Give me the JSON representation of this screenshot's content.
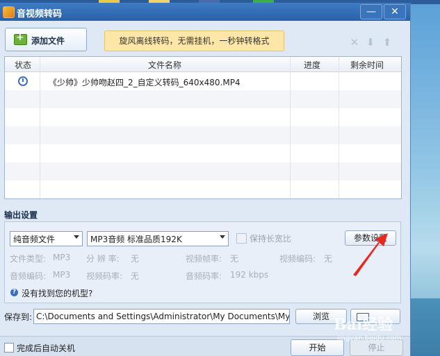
{
  "window": {
    "title": "音视频转码"
  },
  "toolbar": {
    "add_file_label": "添加文件",
    "banner_text": "旋风离线转码，无需挂机，一秒钟转格式"
  },
  "file_list": {
    "columns": [
      "状态",
      "文件名称",
      "进度",
      "剩余时间"
    ],
    "rows": [
      {
        "status_icon": "clock-icon",
        "name": "《少帅》少帅吻赵四_2_自定义转码_640x480.MP4",
        "progress": "",
        "remaining": ""
      }
    ]
  },
  "output_settings": {
    "section_label": "输出设置",
    "format_select": "纯音频文件",
    "preset_select": "MP3音频 标准品质192K",
    "keep_ratio_label": "保持长宽比",
    "param_button": "参数设置",
    "info": {
      "file_type_label": "文件类型:",
      "file_type_value": "MP3",
      "resolution_label": "分 辨 率:",
      "resolution_value": "无",
      "video_fps_label": "视频帧率:",
      "video_fps_value": "无",
      "video_codec_label": "视频编码:",
      "video_codec_value": "无",
      "audio_codec_label": "音频编码:",
      "audio_codec_value": "MP3",
      "video_bitrate_label": "视频码率:",
      "video_bitrate_value": "无",
      "audio_bitrate_label": "音频码率:",
      "audio_bitrate_value": "192 kbps"
    },
    "help_link": "没有找到您的机型?"
  },
  "save": {
    "label": "保存到:",
    "path": "C:\\Documents and Settings\\Administrator\\My Documents\\My Vide",
    "browse_button": "浏览"
  },
  "footer": {
    "shutdown_label": "完成后自动关机",
    "start_button": "开始",
    "stop_button": "停止"
  },
  "watermark": {
    "brand": "Bai经验",
    "url": "jingyan.baidu.com"
  },
  "colors": {
    "title_bar": "#2a62a8",
    "banner": "#fde7a8",
    "arrow": "#e8281e"
  }
}
